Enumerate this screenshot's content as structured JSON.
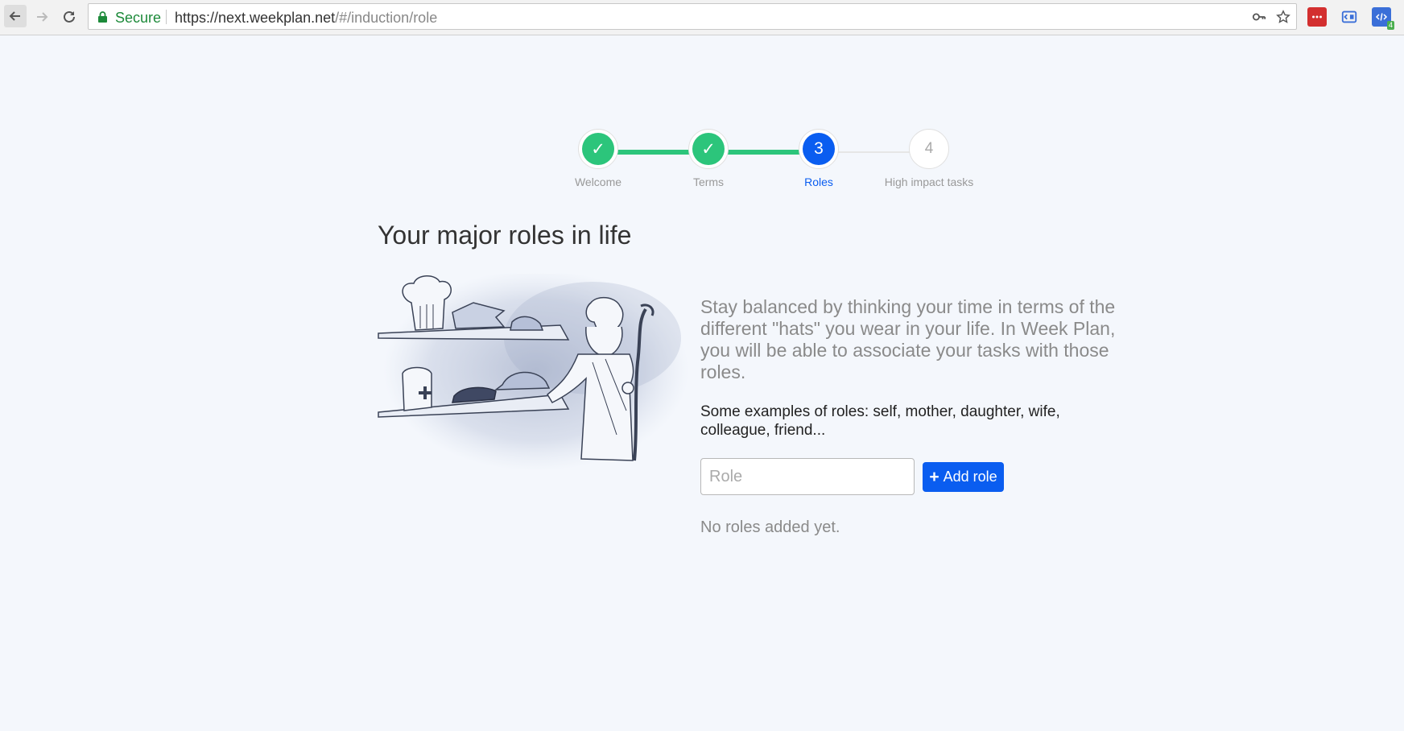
{
  "browser": {
    "secure_label": "Secure",
    "url_base": "https://next.weekplan.net",
    "url_path": "/#/induction/role"
  },
  "stepper": {
    "steps": [
      {
        "label": "Welcome",
        "state": "done",
        "mark": "✓"
      },
      {
        "label": "Terms",
        "state": "done",
        "mark": "✓"
      },
      {
        "label": "Roles",
        "state": "active",
        "mark": "3"
      },
      {
        "label": "High impact tasks",
        "state": "pending",
        "mark": "4"
      }
    ]
  },
  "page": {
    "title": "Your major roles in life",
    "description": "Stay balanced by thinking your time in terms of the different \"hats\" you wear in your life. In Week Plan, you will be able to associate your tasks with those roles.",
    "examples": "Some examples of roles: self, mother, daughter, wife, colleague, friend...",
    "role_placeholder": "Role",
    "add_button_label": "Add role",
    "empty_state": "No roles added yet."
  },
  "colors": {
    "done": "#2cc57b",
    "active": "#0a5df0",
    "accent_button": "#0a5df0",
    "background": "#f4f7fc"
  }
}
